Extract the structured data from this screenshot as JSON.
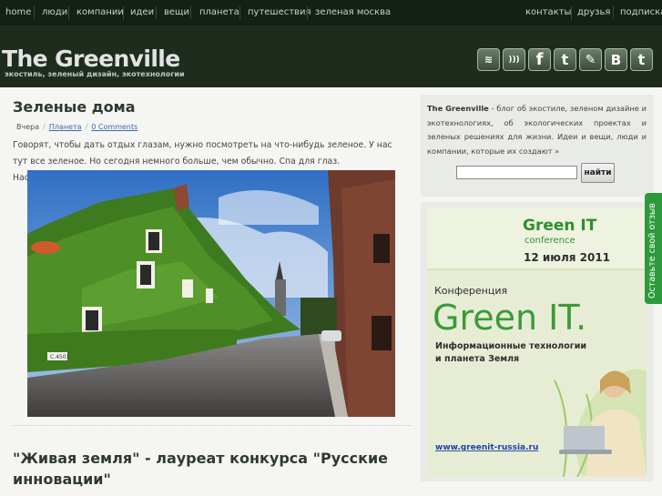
{
  "nav": {
    "left": [
      "home",
      "люди",
      "компании",
      "идеи",
      "вещи",
      "планета",
      "путешествия",
      "зеленая москва"
    ],
    "right": [
      "контакты",
      "друзья",
      "подписка"
    ]
  },
  "header": {
    "logo": "The Greenville",
    "tagline": "экостиль, зеленый дизайн, экотехнологии"
  },
  "social": [
    {
      "icon": "rss-feed-icon",
      "glyph": "≋"
    },
    {
      "icon": "rss-icon",
      "glyph": ")))"
    },
    {
      "icon": "facebook-icon",
      "glyph": "f"
    },
    {
      "icon": "twitter-icon",
      "glyph": "t"
    },
    {
      "icon": "livejournal-icon",
      "glyph": "✎"
    },
    {
      "icon": "vkontakte-icon",
      "glyph": "B"
    },
    {
      "icon": "tumblr-icon",
      "glyph": "t"
    }
  ],
  "post": {
    "title": "Зеленые дома",
    "date": "Вчера",
    "category": "Планета",
    "comments": "0 Comments",
    "excerpt": "Говорят, чтобы дать отдых глазам, нужно посмотреть на что-нибудь зеленое. У нас тут все зеленое. Но сегодня немного больше, чем обычно. Спа для глаз. Наслаждаемся, пятница!",
    "more": "»",
    "plate": "C.4501"
  },
  "post2": {
    "title": "\"Живая земля\" - лауреат конкурса \"Русские инновации\""
  },
  "sidebar": {
    "about_brand": "The Greenville",
    "about_text": " - блог об экостиле, зеленом дизайне и экотехнологиях, об экологических проектах и зеленых решениях для жизни. Идеи и вещи, люди и компании, которые их создают »",
    "search_value": "",
    "search_button": "найти"
  },
  "banner": {
    "event_title": "Green IT",
    "event_sub": "conference",
    "event_date": "12 июля 2011",
    "conf_label": "Конференция",
    "conf_name": "Green IT.",
    "conf_desc1": "Информационные технологии",
    "conf_desc2": "и планета Земля",
    "url": "www.greenit-russia.ru"
  },
  "feedback": "Оставьте свой отзыв",
  "colors": {
    "nav_bg": "#142014",
    "header_bg": "#1e2c1e",
    "content_bg": "#f5f6f3",
    "link": "#3a6aa8",
    "banner_green": "#2f8f2f",
    "feedback_tab": "#2c9a3a"
  }
}
